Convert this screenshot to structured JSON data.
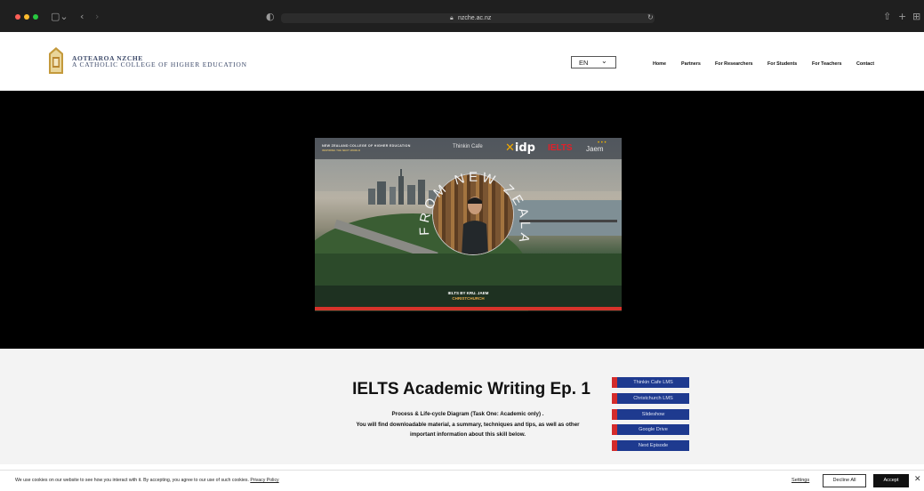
{
  "browser": {
    "url": "nzche.ac.nz"
  },
  "header": {
    "brand_line1": "AOTEAROA NZCHE",
    "brand_line2": "A CATHOLIC COLLEGE OF HIGHER EDUCATION",
    "language": "EN",
    "nav": [
      "Home",
      "Partners",
      "For Researchers",
      "For Students",
      "For Teachers",
      "Contact"
    ]
  },
  "video": {
    "top_left_line1": "NEW ZEALAND COLLEGE OF HIGHER EDUCATION",
    "top_left_line2": "INSPIRING THE NEXT WORLD",
    "thinkin": "Thinkin Cafe",
    "idp": "idp",
    "ielts": "IELTS",
    "jaem": "Jaem",
    "arc_text": "FROM NEW ZEALAND",
    "bottom_line1": "IELTS BY KRU. JAEM",
    "bottom_line2": "CHRISTCHURCH"
  },
  "content": {
    "title": "IELTS Academic Writing Ep. 1",
    "desc_line1": "Process & Life-cycle Diagram (Task One: Academic only) .",
    "desc_line2": "You will find downloadable material, a summary, techniques and tips, as well as other",
    "desc_line3": "important information about this skill below.",
    "buttons": [
      "Thinkin Cafe LMS",
      "Christchurch LMS",
      "Slideshow",
      "Google Drive",
      "Next Episode"
    ]
  },
  "cookie": {
    "text": "We use cookies on our website to see how you interact with it. By accepting, you agree to our use of such cookies.",
    "policy_link": "Privacy Policy",
    "settings": "Settings",
    "decline": "Decline All",
    "accept": "Accept"
  },
  "colors": {
    "button_blue": "#1e3a8f",
    "button_accent": "#d42b2b",
    "brand_text": "#3d4a6a"
  }
}
